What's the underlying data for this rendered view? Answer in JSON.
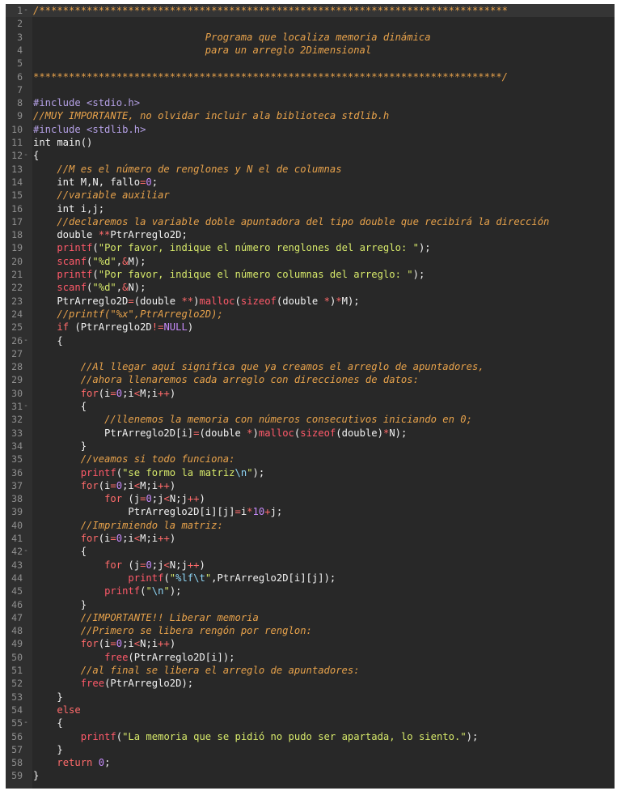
{
  "editor": {
    "theme": {
      "background": "#282828",
      "gutter": "#2f2f2f",
      "line_number": "#8f8f8f",
      "comment": "#e7a24b",
      "preprocessor": "#b4a0e5",
      "keyword": "#ff6b6b",
      "string": "#d6e86a",
      "number": "#c58af9",
      "text": "#f2f2f2"
    },
    "active_line": 1,
    "folded_lines": [
      1,
      12,
      26,
      31,
      42,
      55
    ],
    "lines": [
      [
        [
          "c",
          "/*******************************************************************************"
        ]
      ],
      [],
      [
        [
          "c",
          "                             Programa que localiza memoria dinámica"
        ]
      ],
      [
        [
          "c",
          "                             para un arreglo 2Dimensional"
        ]
      ],
      [],
      [
        [
          "c",
          "*******************************************************************************/"
        ]
      ],
      [],
      [
        [
          "p",
          "#include "
        ],
        [
          "pv",
          "<stdio.h>"
        ]
      ],
      [
        [
          "c",
          "//MUY IMPORTANTE, no olvidar incluir ala biblioteca stdlib.h"
        ]
      ],
      [
        [
          "p",
          "#include "
        ],
        [
          "pv",
          "<stdlib.h>"
        ]
      ],
      [
        [
          "t",
          "int main()"
        ]
      ],
      [
        [
          "t",
          "{"
        ]
      ],
      [
        [
          "t",
          "    "
        ],
        [
          "c",
          "//M es el número de renglones y N el de columnas"
        ]
      ],
      [
        [
          "t",
          "    int M,N, fallo"
        ],
        [
          "o",
          "="
        ],
        [
          "n",
          "0"
        ],
        [
          "t",
          ";"
        ]
      ],
      [
        [
          "t",
          "    "
        ],
        [
          "c",
          "//variable auxiliar"
        ]
      ],
      [
        [
          "t",
          "    int i,j;"
        ]
      ],
      [
        [
          "t",
          "    "
        ],
        [
          "c",
          "//declaremos la variable doble apuntadora del tipo double que recibirá la dirección"
        ]
      ],
      [
        [
          "t",
          "    double "
        ],
        [
          "o",
          "**"
        ],
        [
          "t",
          "PtrArreglo2D;"
        ]
      ],
      [
        [
          "t",
          "    "
        ],
        [
          "f",
          "printf"
        ],
        [
          "t",
          "("
        ],
        [
          "s",
          "\"Por favor, indique el número renglones del arreglo: \""
        ],
        [
          "t",
          ");"
        ]
      ],
      [
        [
          "t",
          "    "
        ],
        [
          "f",
          "scanf"
        ],
        [
          "t",
          "("
        ],
        [
          "s",
          "\"%d\""
        ],
        [
          "t",
          ","
        ],
        [
          "o",
          "&"
        ],
        [
          "t",
          "M);"
        ]
      ],
      [
        [
          "t",
          "    "
        ],
        [
          "f",
          "printf"
        ],
        [
          "t",
          "("
        ],
        [
          "s",
          "\"Por favor, indique el número columnas del arreglo: \""
        ],
        [
          "t",
          ");"
        ]
      ],
      [
        [
          "t",
          "    "
        ],
        [
          "f",
          "scanf"
        ],
        [
          "t",
          "("
        ],
        [
          "s",
          "\"%d\""
        ],
        [
          "t",
          ","
        ],
        [
          "o",
          "&"
        ],
        [
          "t",
          "N);"
        ]
      ],
      [
        [
          "t",
          "    PtrArreglo2D"
        ],
        [
          "o",
          "="
        ],
        [
          "t",
          "(double "
        ],
        [
          "o",
          "**"
        ],
        [
          "t",
          ")"
        ],
        [
          "f",
          "malloc"
        ],
        [
          "t",
          "("
        ],
        [
          "f",
          "sizeof"
        ],
        [
          "t",
          "(double "
        ],
        [
          "o",
          "*"
        ],
        [
          "t",
          ")"
        ],
        [
          "o",
          "*"
        ],
        [
          "t",
          "M);"
        ]
      ],
      [
        [
          "t",
          "    "
        ],
        [
          "c",
          "//printf(\"%x\",PtrArreglo2D);"
        ]
      ],
      [
        [
          "t",
          "    "
        ],
        [
          "k",
          "if"
        ],
        [
          "t",
          " (PtrArreglo2D"
        ],
        [
          "o",
          "!="
        ],
        [
          "nl",
          "NULL"
        ],
        [
          "t",
          ")"
        ]
      ],
      [
        [
          "t",
          "    {"
        ]
      ],
      [],
      [
        [
          "t",
          "        "
        ],
        [
          "c",
          "//Al llegar aquí significa que ya creamos el arreglo de apuntadores,"
        ]
      ],
      [
        [
          "t",
          "        "
        ],
        [
          "c",
          "//ahora llenaremos cada arreglo con direcciones de datos:"
        ]
      ],
      [
        [
          "t",
          "        "
        ],
        [
          "k",
          "for"
        ],
        [
          "t",
          "(i"
        ],
        [
          "o",
          "="
        ],
        [
          "n",
          "0"
        ],
        [
          "t",
          ";i"
        ],
        [
          "o",
          "<"
        ],
        [
          "t",
          "M;i"
        ],
        [
          "o",
          "++"
        ],
        [
          "t",
          ")"
        ]
      ],
      [
        [
          "t",
          "        {"
        ]
      ],
      [
        [
          "t",
          "            "
        ],
        [
          "c",
          "//llenemos la memoria con números consecutivos iniciando en 0;"
        ]
      ],
      [
        [
          "t",
          "            PtrArreglo2D[i]"
        ],
        [
          "o",
          "="
        ],
        [
          "t",
          "(double "
        ],
        [
          "o",
          "*"
        ],
        [
          "t",
          ")"
        ],
        [
          "f",
          "malloc"
        ],
        [
          "t",
          "("
        ],
        [
          "f",
          "sizeof"
        ],
        [
          "t",
          "(double)"
        ],
        [
          "o",
          "*"
        ],
        [
          "t",
          "N);"
        ]
      ],
      [
        [
          "t",
          "        }"
        ]
      ],
      [
        [
          "t",
          "        "
        ],
        [
          "c",
          "//veamos si todo funciona:"
        ]
      ],
      [
        [
          "t",
          "        "
        ],
        [
          "f",
          "printf"
        ],
        [
          "t",
          "("
        ],
        [
          "s",
          "\"se formo la matriz"
        ],
        [
          "e",
          "\\n"
        ],
        [
          "s",
          "\""
        ],
        [
          "t",
          ");"
        ]
      ],
      [
        [
          "t",
          "        "
        ],
        [
          "k",
          "for"
        ],
        [
          "t",
          "(i"
        ],
        [
          "o",
          "="
        ],
        [
          "n",
          "0"
        ],
        [
          "t",
          ";i"
        ],
        [
          "o",
          "<"
        ],
        [
          "t",
          "M;i"
        ],
        [
          "o",
          "++"
        ],
        [
          "t",
          ")"
        ]
      ],
      [
        [
          "t",
          "            "
        ],
        [
          "k",
          "for"
        ],
        [
          "t",
          " (j"
        ],
        [
          "o",
          "="
        ],
        [
          "n",
          "0"
        ],
        [
          "t",
          ";j"
        ],
        [
          "o",
          "<"
        ],
        [
          "t",
          "N;j"
        ],
        [
          "o",
          "++"
        ],
        [
          "t",
          ")"
        ]
      ],
      [
        [
          "t",
          "                PtrArreglo2D[i][j]"
        ],
        [
          "o",
          "="
        ],
        [
          "t",
          "i"
        ],
        [
          "o",
          "*"
        ],
        [
          "n",
          "10"
        ],
        [
          "o",
          "+"
        ],
        [
          "t",
          "j;"
        ]
      ],
      [
        [
          "t",
          "        "
        ],
        [
          "c",
          "//Imprimiendo la matriz:"
        ]
      ],
      [
        [
          "t",
          "        "
        ],
        [
          "k",
          "for"
        ],
        [
          "t",
          "(i"
        ],
        [
          "o",
          "="
        ],
        [
          "n",
          "0"
        ],
        [
          "t",
          ";i"
        ],
        [
          "o",
          "<"
        ],
        [
          "t",
          "M;i"
        ],
        [
          "o",
          "++"
        ],
        [
          "t",
          ")"
        ]
      ],
      [
        [
          "t",
          "        {"
        ]
      ],
      [
        [
          "t",
          "            "
        ],
        [
          "k",
          "for"
        ],
        [
          "t",
          " (j"
        ],
        [
          "o",
          "="
        ],
        [
          "n",
          "0"
        ],
        [
          "t",
          ";j"
        ],
        [
          "o",
          "<"
        ],
        [
          "t",
          "N;j"
        ],
        [
          "o",
          "++"
        ],
        [
          "t",
          ")"
        ]
      ],
      [
        [
          "t",
          "                "
        ],
        [
          "f",
          "printf"
        ],
        [
          "t",
          "("
        ],
        [
          "s",
          "\""
        ],
        [
          "e",
          "%lf\\t"
        ],
        [
          "s",
          "\""
        ],
        [
          "t",
          ",PtrArreglo2D[i][j]);"
        ]
      ],
      [
        [
          "t",
          "            "
        ],
        [
          "f",
          "printf"
        ],
        [
          "t",
          "("
        ],
        [
          "s",
          "\""
        ],
        [
          "e",
          "\\n"
        ],
        [
          "s",
          "\""
        ],
        [
          "t",
          ");"
        ]
      ],
      [
        [
          "t",
          "        }"
        ]
      ],
      [
        [
          "t",
          "        "
        ],
        [
          "c",
          "//IMPORTANTE!! Liberar memoria"
        ]
      ],
      [
        [
          "t",
          "        "
        ],
        [
          "c",
          "//Primero se libera rengón por renglon:"
        ]
      ],
      [
        [
          "t",
          "        "
        ],
        [
          "k",
          "for"
        ],
        [
          "t",
          "(i"
        ],
        [
          "o",
          "="
        ],
        [
          "n",
          "0"
        ],
        [
          "t",
          ";i"
        ],
        [
          "o",
          "<"
        ],
        [
          "t",
          "N;i"
        ],
        [
          "o",
          "++"
        ],
        [
          "t",
          ")"
        ]
      ],
      [
        [
          "t",
          "            "
        ],
        [
          "f",
          "free"
        ],
        [
          "t",
          "(PtrArreglo2D[i]);"
        ]
      ],
      [
        [
          "t",
          "        "
        ],
        [
          "c",
          "//al final se libera el arreglo de apuntadores:"
        ]
      ],
      [
        [
          "t",
          "        "
        ],
        [
          "f",
          "free"
        ],
        [
          "t",
          "(PtrArreglo2D);"
        ]
      ],
      [
        [
          "t",
          "    }"
        ]
      ],
      [
        [
          "t",
          "    "
        ],
        [
          "k",
          "else"
        ]
      ],
      [
        [
          "t",
          "    {"
        ]
      ],
      [
        [
          "t",
          "        "
        ],
        [
          "f",
          "printf"
        ],
        [
          "t",
          "("
        ],
        [
          "s",
          "\"La memoria que se pidió no pudo ser apartada, lo siento.\""
        ],
        [
          "t",
          ");"
        ]
      ],
      [
        [
          "t",
          "    }"
        ]
      ],
      [
        [
          "t",
          "    "
        ],
        [
          "k",
          "return"
        ],
        [
          "t",
          " "
        ],
        [
          "n",
          "0"
        ],
        [
          "t",
          ";"
        ]
      ],
      [
        [
          "t",
          "}"
        ]
      ]
    ]
  }
}
